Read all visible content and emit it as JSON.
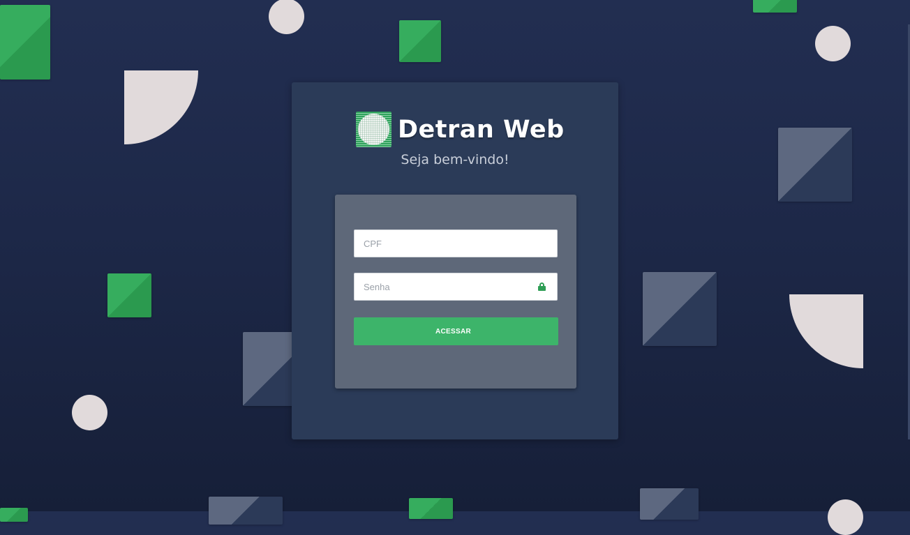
{
  "brand": {
    "name": "Detran Web",
    "logo_icon": "detran-globe-logo"
  },
  "welcome": "Seja bem-vindo!",
  "form": {
    "cpf": {
      "placeholder": "CPF",
      "value": ""
    },
    "senha": {
      "placeholder": "Senha",
      "value": "",
      "icon": "lock-icon"
    },
    "submit_label": "ACESSAR"
  },
  "colors": {
    "background": "#1d2848",
    "card": "#2b3b58",
    "panel": "#5e6879",
    "accent_green": "#3db46a",
    "decor_light": "#e1dadb"
  }
}
